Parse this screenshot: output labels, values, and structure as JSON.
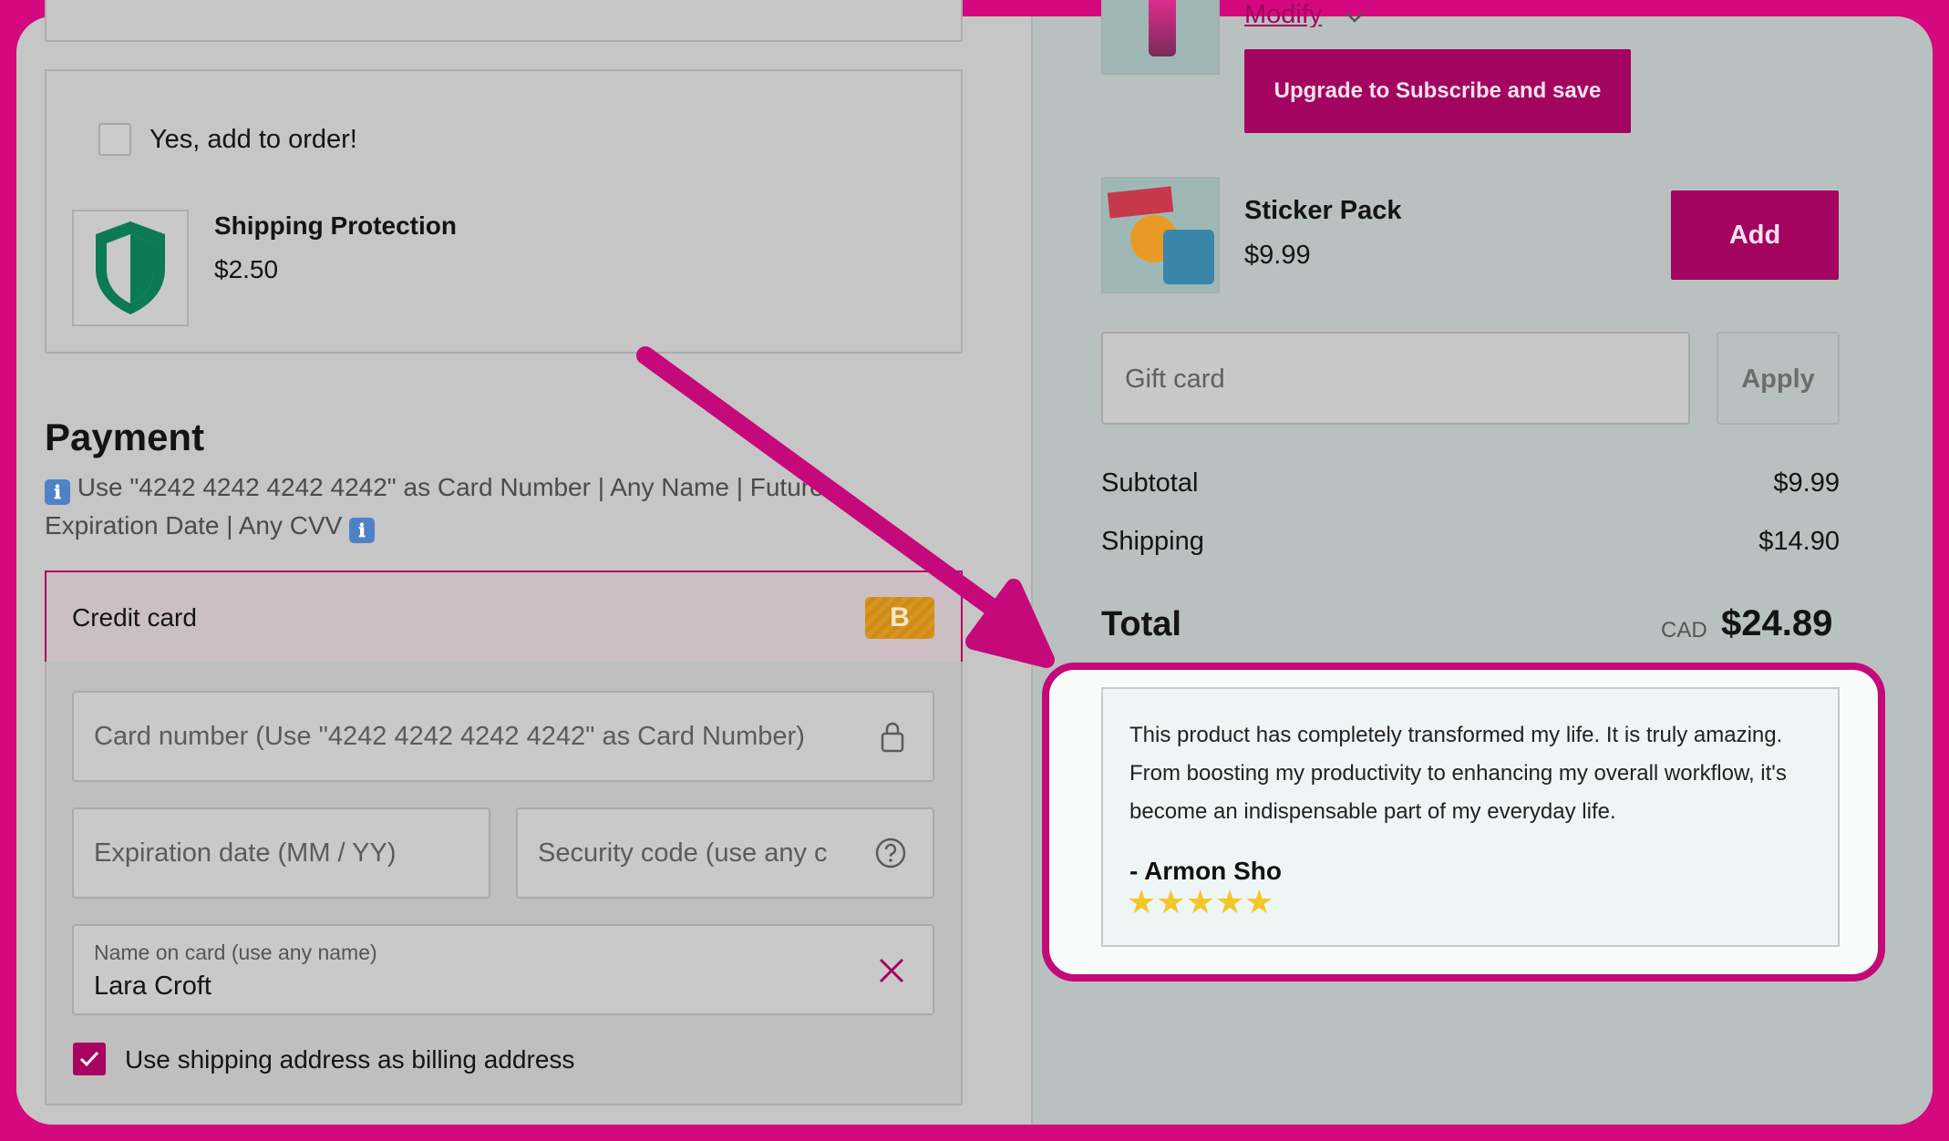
{
  "upsell": {
    "checkbox_label": "Yes, add to order!",
    "product_name": "Shipping Protection",
    "product_price": "$2.50"
  },
  "payment": {
    "title": "Payment",
    "info_icon": "ℹ",
    "note": "Use \"4242 4242 4242 4242\" as Card Number | Any Name | Future Expiration Date | Any CVV",
    "method_label": "Credit card",
    "method_badge": "B",
    "card_number_placeholder": "Card number (Use \"4242 4242 4242 4242\" as Card Number)",
    "expiration_placeholder": "Expiration date (MM / YY)",
    "security_placeholder": "Security code (use any c",
    "name_label": "Name on card (use any name)",
    "name_value": "Lara Croft",
    "billing_label": "Use shipping address as billing address"
  },
  "order": {
    "modify_link": "Modify",
    "subscribe_button": "Upgrade to Subscribe and save",
    "upsell_item_name": "Sticker Pack",
    "upsell_item_price": "$9.99",
    "add_button": "Add",
    "gift_card_placeholder": "Gift card",
    "apply_button": "Apply",
    "subtotal_label": "Subtotal",
    "subtotal_value": "$9.99",
    "shipping_label": "Shipping",
    "shipping_value": "$14.90",
    "total_label": "Total",
    "currency": "CAD",
    "total_value": "$24.89"
  },
  "review": {
    "text": "This product has completely transformed my life. It is truly amazing. From boosting my productivity to enhancing my overall workflow, it's become an indispensable part of my everyday life.",
    "author": "- Armon Sho",
    "stars": "★★★★★"
  },
  "colors": {
    "accent": "#a3045f",
    "frame": "#d4097f",
    "star": "#f3c62a"
  }
}
